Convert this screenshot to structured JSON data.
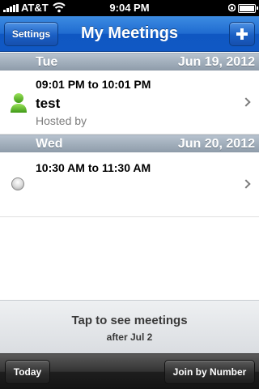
{
  "status_bar": {
    "carrier": "AT&T",
    "time": "9:04 PM",
    "icons": [
      "signal-bars-icon",
      "wifi-icon",
      "lock-rotation-icon",
      "battery-icon"
    ]
  },
  "nav": {
    "title": "My Meetings",
    "settings_label": "Settings",
    "add_icon": "plus-icon",
    "accent_color": "#1f6bd0"
  },
  "sections": [
    {
      "day": "Tue",
      "date": "Jun 19, 2012",
      "meeting": {
        "time": "09:01 PM to 10:01 PM",
        "title": "test",
        "host": "Hosted by",
        "icon": "person-icon",
        "icon_color": "#5cb82c"
      }
    },
    {
      "day": "Wed",
      "date": "Jun 20, 2012",
      "meeting": {
        "time": "10:30 AM to 11:30 AM",
        "title": "",
        "host": "",
        "icon": "status-dot-icon"
      }
    }
  ],
  "more": {
    "line1": "Tap to see meetings",
    "line2": "after Jul 2"
  },
  "toolbar": {
    "today_label": "Today",
    "join_label": "Join by Number"
  }
}
